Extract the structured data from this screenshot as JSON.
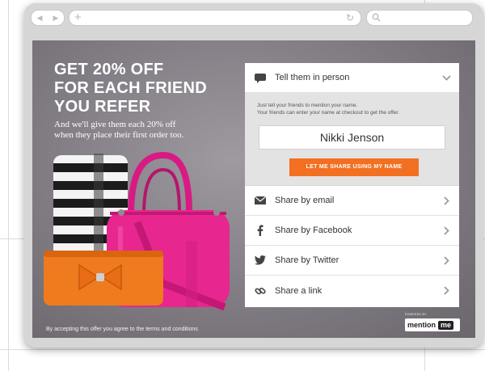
{
  "browser": {
    "nav_back_icon": "back-arrow-icon",
    "nav_forward_icon": "forward-arrow-icon",
    "new_tab_icon": "plus-icon",
    "reload_icon": "reload-icon",
    "search_icon": "search-icon",
    "back_glyph": "◀",
    "forward_glyph": "▶",
    "plus_glyph": "+",
    "reload_glyph": "↻"
  },
  "promo": {
    "headline_line1": "GET 20% OFF",
    "headline_line2": "FOR EACH FRIEND",
    "headline_line3": "YOU REFER",
    "sub_line1": "And we'll give them each 20% off",
    "sub_line2": "when they place their first order too.",
    "terms": "By accepting this offer you agree to the terms and conditions"
  },
  "share_panel": {
    "in_person": {
      "label": "Tell them in person",
      "icon": "speech-bubble-icon",
      "desc_line1": "Just tell your friends to mention your name.",
      "desc_line2": "Your friends can enter your name at checkout to get the offer.",
      "name_value": "Nikki Jenson",
      "button_label": "LET ME SHARE USING MY NAME"
    },
    "options": [
      {
        "label": "Share by email",
        "icon": "envelope-icon"
      },
      {
        "label": "Share by Facebook",
        "icon": "facebook-icon"
      },
      {
        "label": "Share by Twitter",
        "icon": "twitter-icon"
      },
      {
        "label": "Share a link",
        "icon": "link-icon"
      }
    ]
  },
  "brand": {
    "powered_by": "POWERED BY",
    "logo_part1": "mention",
    "logo_part2": "me"
  },
  "colors": {
    "accent": "#f36f21",
    "background": "#847f86",
    "bag_pink": "#e8268f",
    "wallet_orange": "#f07a1e"
  }
}
